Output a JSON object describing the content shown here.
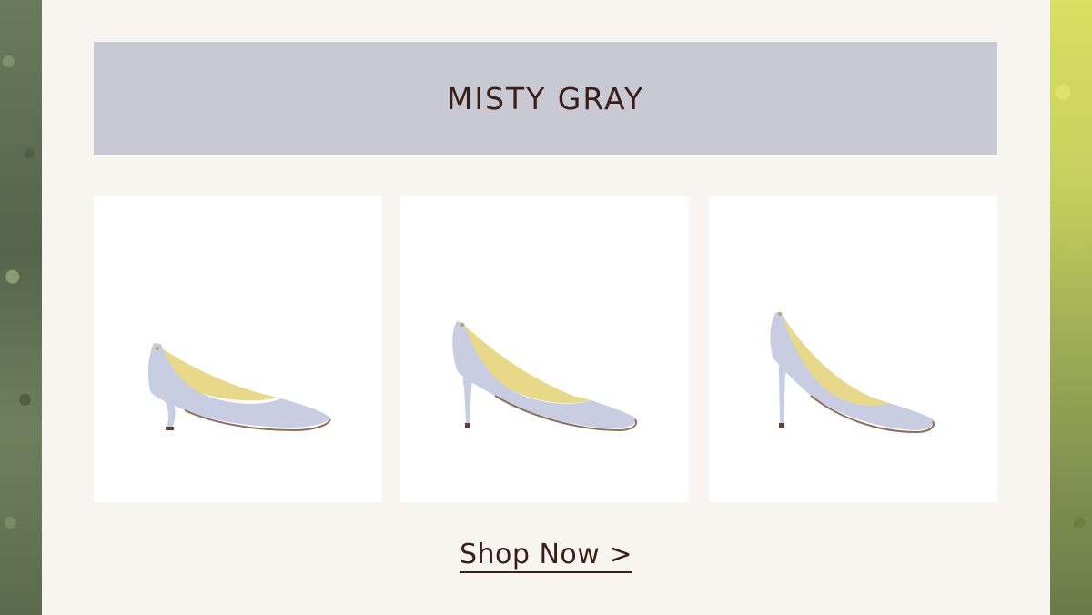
{
  "banner": {
    "title": "MISTY GRAY",
    "color": "#c8c9d2"
  },
  "products": [
    {
      "name": "kitten-heel-pump",
      "color": "#c9cde2"
    },
    {
      "name": "mid-heel-pump",
      "color": "#c9cde2"
    },
    {
      "name": "high-heel-pump",
      "color": "#c9cde2"
    }
  ],
  "cta": {
    "label": "Shop Now >"
  },
  "colors": {
    "panel": "#f8f5f0",
    "text": "#3a1e1a",
    "lining": "#e8d88a"
  }
}
